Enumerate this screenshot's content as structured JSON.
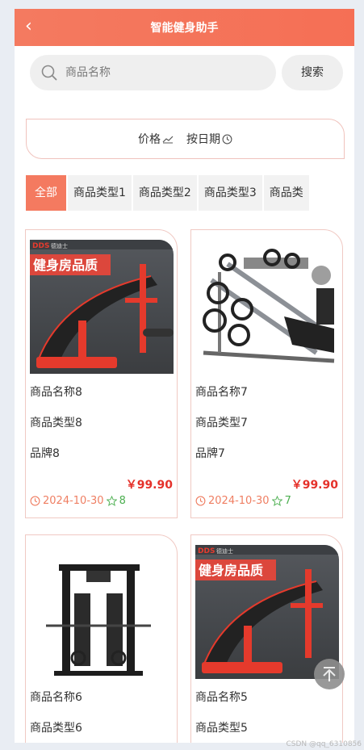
{
  "header": {
    "title": "智能健身助手"
  },
  "search": {
    "placeholder": "商品名称",
    "button": "搜索"
  },
  "sort": {
    "price": "价格",
    "date": "按日期"
  },
  "tabs": [
    "全部",
    "商品类型1",
    "商品类型2",
    "商品类型3",
    "商品类"
  ],
  "products": [
    {
      "name": "商品名称8",
      "type": "商品类型8",
      "brand": "品牌8",
      "price": "￥99.90",
      "date": "2024-10-30",
      "stars": "8",
      "image": "sit-up-bench",
      "banner": "健身房品质",
      "logo_text": "DDS 德迪士"
    },
    {
      "name": "商品名称7",
      "type": "商品类型7",
      "brand": "品牌7",
      "price": "￥99.90",
      "date": "2024-10-30",
      "stars": "7",
      "image": "leg-press-machine"
    },
    {
      "name": "商品名称6",
      "type": "商品类型6",
      "image": "cable-crossover-machine"
    },
    {
      "name": "商品名称5",
      "type": "商品类型5",
      "image": "sit-up-bench",
      "banner": "健身房品质",
      "logo_text": "DDS 德迪士"
    }
  ],
  "watermark": "CSDN @qq_6310856",
  "colors": {
    "accent": "#f47a60",
    "price": "#e5312a",
    "stars": "#4caf50",
    "date": "#ef7e62"
  }
}
